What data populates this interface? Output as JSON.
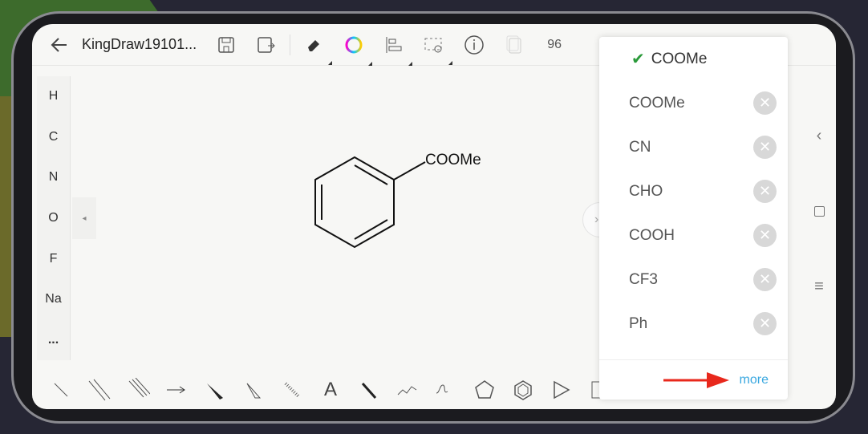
{
  "header": {
    "back_icon": "arrow-left-icon",
    "title": "KingDraw19101...",
    "zoom": "96",
    "tools": [
      "save-icon",
      "save-as-icon",
      "eraser-icon",
      "color-wheel-icon",
      "align-icon",
      "select-icon",
      "info-icon",
      "copy-icon"
    ]
  },
  "palette": {
    "elements": [
      "H",
      "C",
      "N",
      "O",
      "F",
      "Na",
      "..."
    ]
  },
  "molecule": {
    "group_label": "COOMe"
  },
  "panel": {
    "selected": "COOMe",
    "items": [
      "COOMe",
      "CN",
      "CHO",
      "COOH",
      "CF3",
      "Ph"
    ],
    "more": "more"
  },
  "colors": {
    "accent": "#3aa8e0",
    "check": "#2a9a3a",
    "arrow": "#e8281c"
  }
}
